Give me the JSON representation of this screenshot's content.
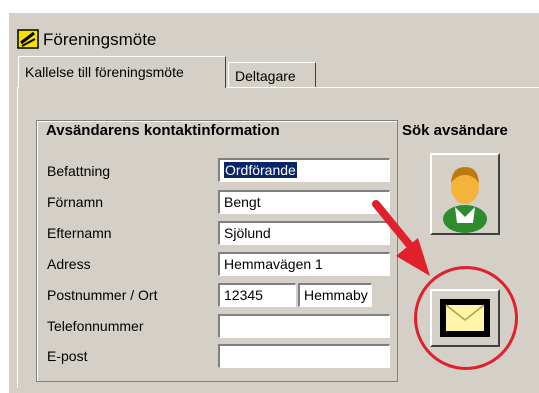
{
  "window": {
    "title": "Föreningsmöte"
  },
  "tabs": [
    {
      "label": "Kallelse till föreningsmöte",
      "active": true
    },
    {
      "label": "Deltagare",
      "active": false
    }
  ],
  "form": {
    "section_title": "Avsändarens kontaktinformation",
    "search_title": "Sök avsändare",
    "fields": {
      "befattning": {
        "label": "Befattning",
        "value": "Ordförande"
      },
      "fornamn": {
        "label": "Förnamn",
        "value": "Bengt"
      },
      "efternamn": {
        "label": "Efternamn",
        "value": "Sjölund"
      },
      "adress": {
        "label": "Adress",
        "value": "Hemmavägen 1"
      },
      "postnummer": {
        "label": "Postnummer / Ort",
        "value": "12345",
        "ort": "Hemmaby"
      },
      "telefon": {
        "label": "Telefonnummer",
        "value": ""
      },
      "epost": {
        "label": "E-post",
        "value": ""
      }
    }
  },
  "buttons": {
    "contact_icon": "person-icon",
    "email_icon": "envelope-icon"
  },
  "colors": {
    "highlight": "#0a246a",
    "annotation_red": "#e0202a"
  }
}
